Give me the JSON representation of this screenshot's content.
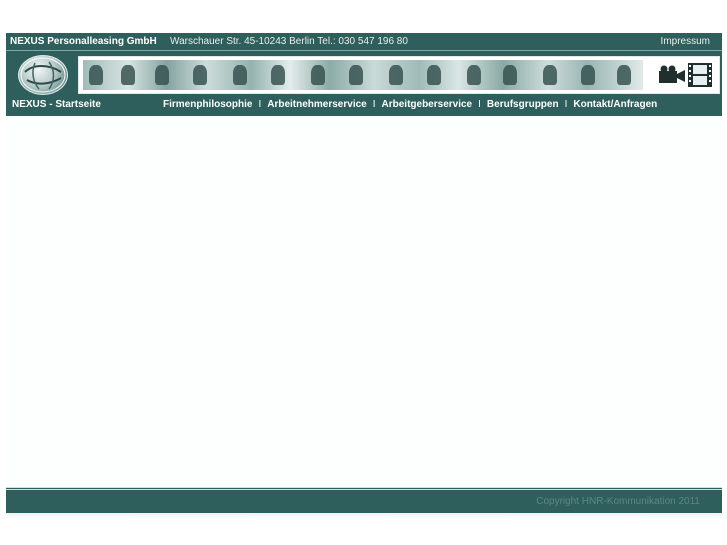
{
  "header": {
    "company": "NEXUS Personalleasing GmbH",
    "address": "Warschauer Str. 45-10243 Berlin   Tel.: 030 547 196 80",
    "impressum": "Impressum"
  },
  "nav": {
    "home": "NEXUS - Startseite",
    "items": [
      {
        "label": "Firmenphilosophie"
      },
      {
        "label": "Arbeitnehmerservice"
      },
      {
        "label": "Arbeitgeberservice"
      },
      {
        "label": "Berufsgruppen"
      },
      {
        "label": "Kontakt/Anfragen"
      }
    ],
    "separator": "I"
  },
  "footer": {
    "copyright": "Copyright HNR-Kommunikation 2011"
  },
  "colors": {
    "brand": "#2f5f5c",
    "footer_text": "#5f8683"
  },
  "icons": [
    "globe-logo-icon",
    "video-camera-icon",
    "film-strip-icon"
  ]
}
